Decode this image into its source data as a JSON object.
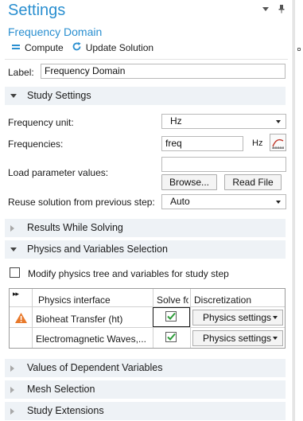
{
  "panel": {
    "title": "Settings",
    "subtitle": "Frequency Domain"
  },
  "toolbar": {
    "compute_label": "Compute",
    "update_label": "Update Solution"
  },
  "label_field": {
    "label": "Label:",
    "value": "Frequency Domain"
  },
  "study_settings": {
    "header": "Study Settings",
    "frequency_unit_label": "Frequency unit:",
    "frequency_unit_value": "Hz",
    "frequencies_label": "Frequencies:",
    "frequencies_value": "freq",
    "frequencies_unit": "Hz",
    "load_param_label": "Load parameter values:",
    "load_param_value": "",
    "browse_label": "Browse...",
    "read_file_label": "Read File",
    "reuse_label": "Reuse solution from previous step:",
    "reuse_value": "Auto"
  },
  "results_while_solving": {
    "header": "Results While Solving"
  },
  "physics_selection": {
    "header": "Physics and Variables Selection",
    "modify_label": "Modify physics tree and variables for study step",
    "modify_checked": false,
    "columns": [
      "Physics interface",
      "Solve fo",
      "Discretization"
    ],
    "rows": [
      {
        "interface": "Bioheat Transfer (ht)",
        "solve": true,
        "discretization": "Physics settings",
        "warning": true
      },
      {
        "interface": "Electromagnetic Waves,...",
        "solve": true,
        "discretization": "Physics settings",
        "warning": false
      }
    ]
  },
  "dependent_variables": {
    "header": "Values of Dependent Variables"
  },
  "mesh_selection": {
    "header": "Mesh Selection"
  },
  "study_extensions": {
    "header": "Study Extensions"
  },
  "colors": {
    "title_blue": "#2a8fd0",
    "section_bg": "#eef2f6",
    "check_green": "#2e9d3a",
    "warning_orange": "#e8792b"
  }
}
